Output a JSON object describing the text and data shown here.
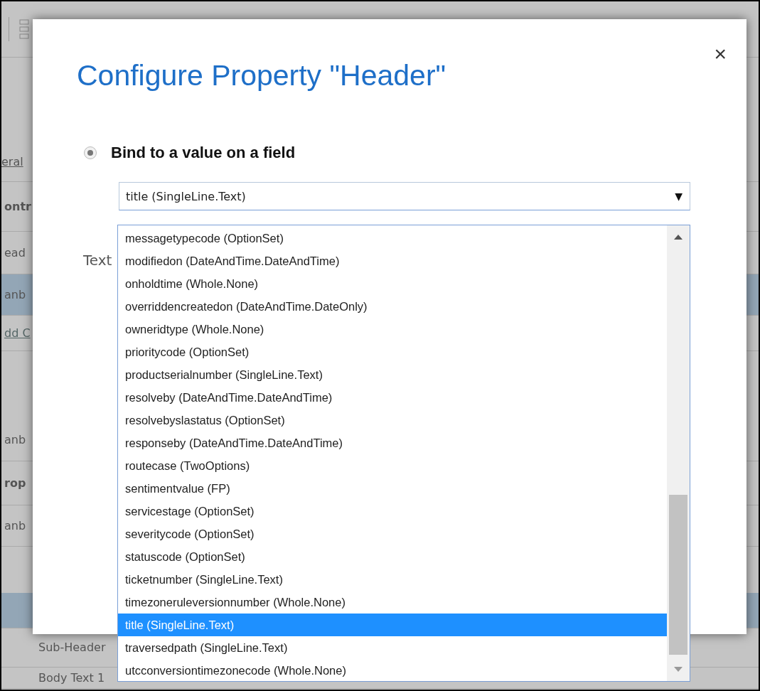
{
  "background": {
    "rows": [
      {
        "kind": "tab",
        "text": "eral",
        "selected": false
      },
      {
        "kind": "heading",
        "text": "ontr",
        "selected": false
      },
      {
        "kind": "item",
        "text": "ead",
        "selected": false
      },
      {
        "kind": "item",
        "text": "anb",
        "selected": true
      },
      {
        "kind": "link",
        "text": "dd C",
        "selected": false
      },
      {
        "kind": "item",
        "text": "anb",
        "selected": false
      },
      {
        "kind": "heading",
        "text": "rop",
        "selected": false
      },
      {
        "kind": "item",
        "text": "anb",
        "selected": false
      },
      {
        "kind": "item",
        "selected": true
      },
      {
        "kind": "item",
        "text": "Sub-Header",
        "selected": false
      },
      {
        "kind": "item",
        "text": "Body Text 1",
        "selected": false
      }
    ]
  },
  "dialog": {
    "title": "Configure Property \"Header\"",
    "close": "×",
    "bind": {
      "label": "Bind to a value on a field",
      "selected": true
    },
    "text_label": "Text",
    "select": {
      "value": "title (SingleLine.Text)",
      "arrow": "▼",
      "expanded": true
    },
    "options": [
      {
        "label": "messagetypecode (OptionSet)",
        "selected": false
      },
      {
        "label": "modifiedon (DateAndTime.DateAndTime)",
        "selected": false
      },
      {
        "label": "onholdtime (Whole.None)",
        "selected": false
      },
      {
        "label": "overriddencreatedon (DateAndTime.DateOnly)",
        "selected": false
      },
      {
        "label": "owneridtype (Whole.None)",
        "selected": false
      },
      {
        "label": "prioritycode (OptionSet)",
        "selected": false
      },
      {
        "label": "productserialnumber (SingleLine.Text)",
        "selected": false
      },
      {
        "label": "resolveby (DateAndTime.DateAndTime)",
        "selected": false
      },
      {
        "label": "resolvebyslastatus (OptionSet)",
        "selected": false
      },
      {
        "label": "responseby (DateAndTime.DateAndTime)",
        "selected": false
      },
      {
        "label": "routecase (TwoOptions)",
        "selected": false
      },
      {
        "label": "sentimentvalue (FP)",
        "selected": false
      },
      {
        "label": "servicestage (OptionSet)",
        "selected": false
      },
      {
        "label": "severitycode (OptionSet)",
        "selected": false
      },
      {
        "label": "statuscode (OptionSet)",
        "selected": false
      },
      {
        "label": "ticketnumber (SingleLine.Text)",
        "selected": false
      },
      {
        "label": "timezoneruleversionnumber (Whole.None)",
        "selected": false
      },
      {
        "label": "title (SingleLine.Text)",
        "selected": true
      },
      {
        "label": "traversedpath (SingleLine.Text)",
        "selected": false
      },
      {
        "label": "utcconversiontimezonecode (Whole.None)",
        "selected": false
      }
    ]
  }
}
